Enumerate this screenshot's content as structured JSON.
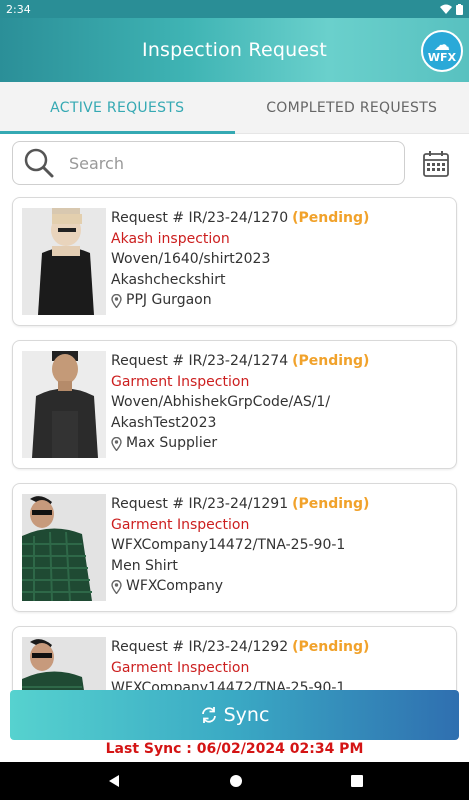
{
  "status_bar": {
    "time": "2:34"
  },
  "app_bar": {
    "title": "Inspection Request",
    "logo_text": "WFX"
  },
  "tabs": [
    {
      "label": "ACTIVE REQUESTS",
      "active": true
    },
    {
      "label": "COMPLETED REQUESTS",
      "active": false
    }
  ],
  "search": {
    "placeholder": "Search",
    "value": ""
  },
  "requests": [
    {
      "request_no": "Request # IR/23-24/1270",
      "status": "(Pending)",
      "type": "Akash inspection",
      "line1": "Woven/1640/shirt2023",
      "line2": "Akashcheckshirt",
      "location": "PPJ Gurgaon"
    },
    {
      "request_no": "Request # IR/23-24/1274",
      "status": "(Pending)",
      "type": "Garment Inspection",
      "line1": "Woven/AbhishekGrpCode/AS/1/",
      "line2": "AkashTest2023",
      "location": "Max Supplier"
    },
    {
      "request_no": "Request # IR/23-24/1291",
      "status": "(Pending)",
      "type": "Garment Inspection",
      "line1": "WFXCompany14472/TNA-25-90-1",
      "line2": "Men Shirt",
      "location": "WFXCompany"
    },
    {
      "request_no": "Request # IR/23-24/1292",
      "status": "(Pending)",
      "type": "Garment Inspection",
      "line1": "WFXCompany14472/TNA-25-90-1",
      "line2": "",
      "location": ""
    }
  ],
  "sync_button": {
    "label": "Sync"
  },
  "last_sync": {
    "text": "Last Sync :  06/02/2024 02:34 PM"
  },
  "colors": {
    "accent": "#35a9b3",
    "pending": "#f1a22b",
    "inspection_type": "#cc1f1f",
    "last_sync": "#d41414"
  },
  "icons": [
    "wifi-icon",
    "battery-icon",
    "search-icon",
    "calendar-icon",
    "location-pin-icon",
    "sync-icon",
    "back-icon",
    "home-icon",
    "recents-icon"
  ]
}
